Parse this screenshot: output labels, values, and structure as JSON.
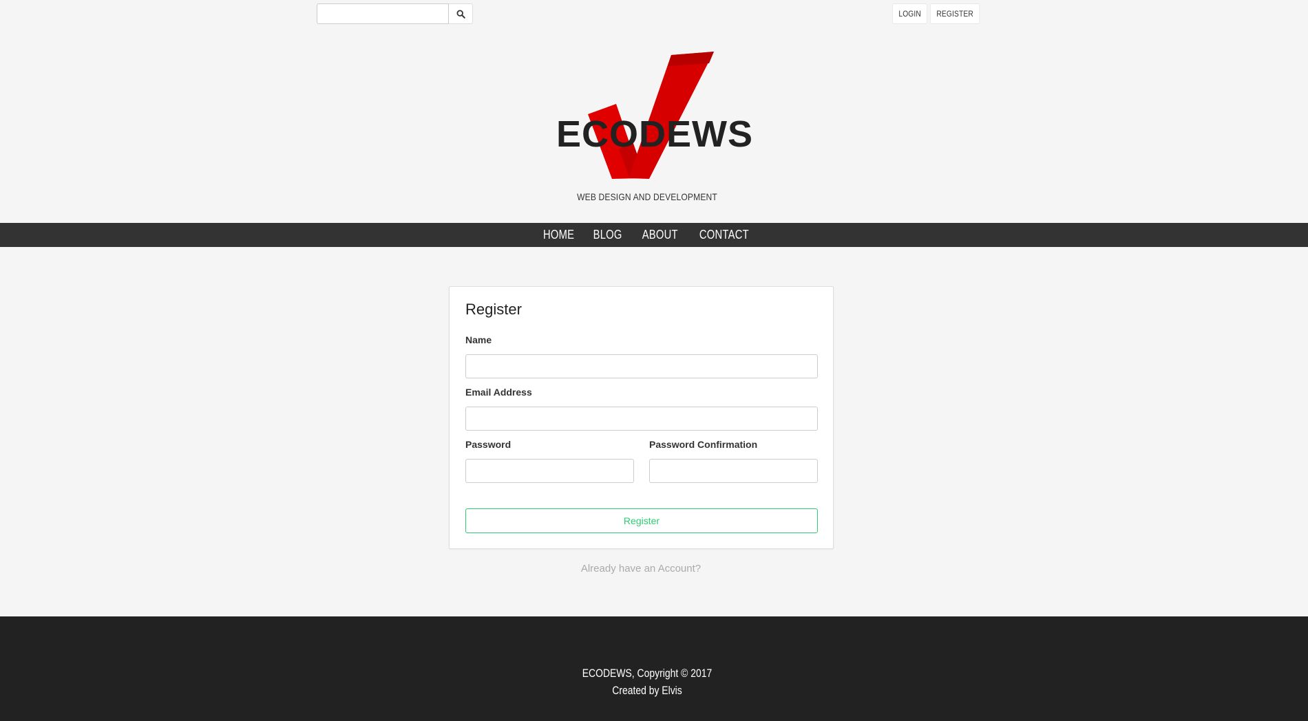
{
  "header": {
    "search": {
      "placeholder": "",
      "value": ""
    },
    "auth": {
      "login_label": "LOGIN",
      "register_label": "REGISTER"
    }
  },
  "brand": {
    "name": "ECODEWS",
    "tagline": "WEB DESIGN AND DEVELOPMENT",
    "accent_color": "#e00000"
  },
  "nav": {
    "items": [
      {
        "label": "HOME"
      },
      {
        "label": "BLOG"
      },
      {
        "label": "ABOUT"
      },
      {
        "label": "CONTACT"
      }
    ]
  },
  "register_form": {
    "title": "Register",
    "name_label": "Name",
    "email_label": "Email Address",
    "password_label": "Password",
    "password_confirm_label": "Password Confirmation",
    "name_value": "",
    "email_value": "",
    "password_value": "",
    "password_confirm_value": "",
    "submit_label": "Register",
    "submit_color": "#2ecc71",
    "login_link": "Already have an Account?"
  },
  "footer": {
    "copyright": "ECODEWS, Copyright © 2017",
    "credit": "Created by Elvis"
  }
}
